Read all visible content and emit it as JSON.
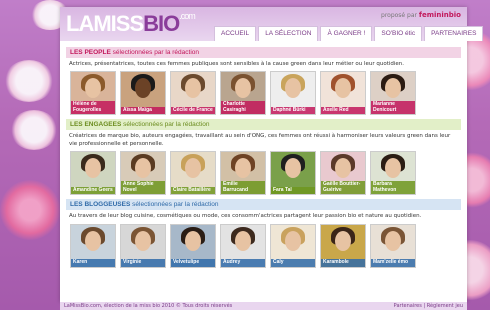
{
  "header": {
    "logo_part1": "LAMISS",
    "logo_part2": "BIO",
    "logo_com": ".com",
    "promo_prefix": "proposé par",
    "promo_brand": "femininbio"
  },
  "nav": [
    "ACCUEIL",
    "LA SÉLECTION",
    "À GAGNER !",
    "SO'BIO étic",
    "PARTENAIRES"
  ],
  "sections": {
    "people": {
      "title": "LES PEOPLE",
      "subtitle": "sélectionnées par la rédaction",
      "desc": "Actrices, présentatrices, toutes ces femmes publiques sont sensibles à la cause green dans leur métier ou leur quotidien.",
      "items": [
        "Hélène de Fougerolles",
        "Aïssa Maïga",
        "Cécile de France",
        "Charlotte Casiraghi",
        "Daphné Bürki",
        "Axelle Red",
        "Marianne Denicourt"
      ]
    },
    "engagees": {
      "title": "LES ENGAGEES",
      "subtitle": "sélectionnées par la rédaction",
      "desc": "Créatrices de marque bio, auteurs engagées, travaillant au sein d'ONG, ces femmes ont réussi à harmoniser leurs valeurs green dans leur vie professionnelle et personnelle.",
      "items": [
        "Amandine Geers",
        "Anne Sophie Novel",
        "Claire Bataillère",
        "Emilie Barrucand",
        "Fara Tal",
        "Gaëlle Bouttier-Guérive",
        "Barbara Mathevon"
      ]
    },
    "bloggeuses": {
      "title": "LES BLOGGEUSES",
      "subtitle": "sélectionnées par la rédaction",
      "desc": "Au travers de leur blog cuisine, cosmétiques ou mode, ces consomm'actrices partagent leur passion bio et nature au quotidien.",
      "items": [
        "Karen",
        "Virginie",
        "Velvetulipe",
        "Audrey",
        "Caly",
        "Karambole",
        "Mam'zelle émo"
      ]
    }
  },
  "footer": {
    "left": "LaMissBio.com, élection de la miss bio 2010 © Tous droits réservés",
    "right": "Partenaires | Règlement jeu"
  },
  "colors": {
    "background": "#b46ab7",
    "people_accent": "#c2185b",
    "engagees_accent": "#6b8c1e",
    "bloggeuses_accent": "#2f6aa8"
  }
}
